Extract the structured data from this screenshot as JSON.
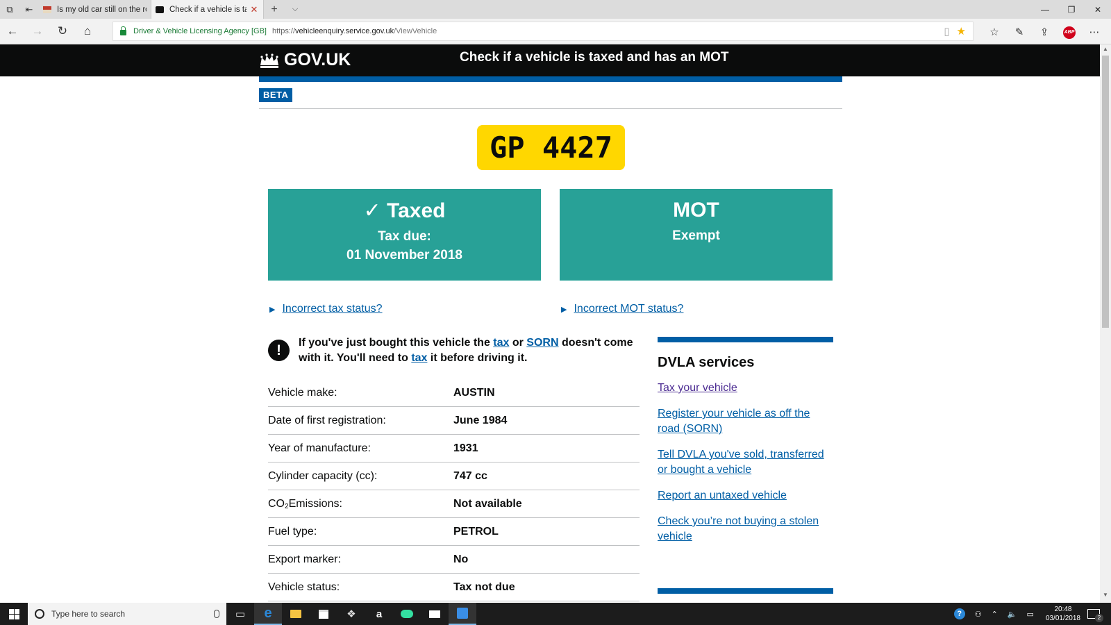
{
  "browser": {
    "tabs": [
      {
        "title": "Is my old car still on the roa"
      },
      {
        "title": "Check if a vehicle is taxe"
      }
    ],
    "address": {
      "cert": "Driver & Vehicle Licensing Agency [GB]",
      "proto": "https://",
      "host": "vehicleenquiry.service.gov.uk",
      "path": "/ViewVehicle"
    }
  },
  "header": {
    "logo": "GOV.UK",
    "service": "Check if a vehicle is taxed and has an MOT",
    "phase": "BETA"
  },
  "vehicle": {
    "plate": "GP 4427"
  },
  "tax_panel": {
    "heading": "✓ Taxed",
    "line1": "Tax due:",
    "line2": "01 November 2018"
  },
  "mot_panel": {
    "heading": "MOT",
    "line1": "Exempt"
  },
  "toggles": {
    "tax": "Incorrect tax status?",
    "mot": "Incorrect MOT status?"
  },
  "warning": {
    "part1": "If you've just bought this vehicle the ",
    "link_tax": "tax",
    "part2": " or ",
    "link_sorn": "SORN",
    "part3": " doesn't come with it. You'll need to ",
    "link_tax2": "tax",
    "part4": " it before driving it."
  },
  "details": [
    {
      "label": "Vehicle make:",
      "value": "AUSTIN"
    },
    {
      "label": "Date of first registration:",
      "value": "June 1984"
    },
    {
      "label": "Year of manufacture:",
      "value": "1931"
    },
    {
      "label": "Cylinder capacity (cc):",
      "value": "747 cc"
    },
    {
      "label_pre": "CO",
      "label_sub": "2",
      "label_post": "Emissions:",
      "value": "Not available"
    },
    {
      "label": "Fuel type:",
      "value": "PETROL"
    },
    {
      "label": "Export marker:",
      "value": "No"
    },
    {
      "label": "Vehicle status:",
      "value": "Tax not due"
    }
  ],
  "sidebar": {
    "title": "DVLA services",
    "links": [
      {
        "label": "Tax your vehicle"
      },
      {
        "label": "Register your vehicle as off the road (SORN)"
      },
      {
        "label": "Tell DVLA you've sold, transferred or bought a vehicle"
      },
      {
        "label": "Report an untaxed vehicle"
      },
      {
        "label": "Check you’re not buying a stolen vehicle"
      }
    ]
  },
  "taskbar": {
    "search_placeholder": "Type here to search",
    "time": "20:48",
    "date": "03/01/2018",
    "notifications": "2"
  },
  "colors": {
    "status_panel": "#28a197",
    "link": "#005ea5",
    "plate": "#ffd700",
    "header": "#0b0c0c"
  }
}
